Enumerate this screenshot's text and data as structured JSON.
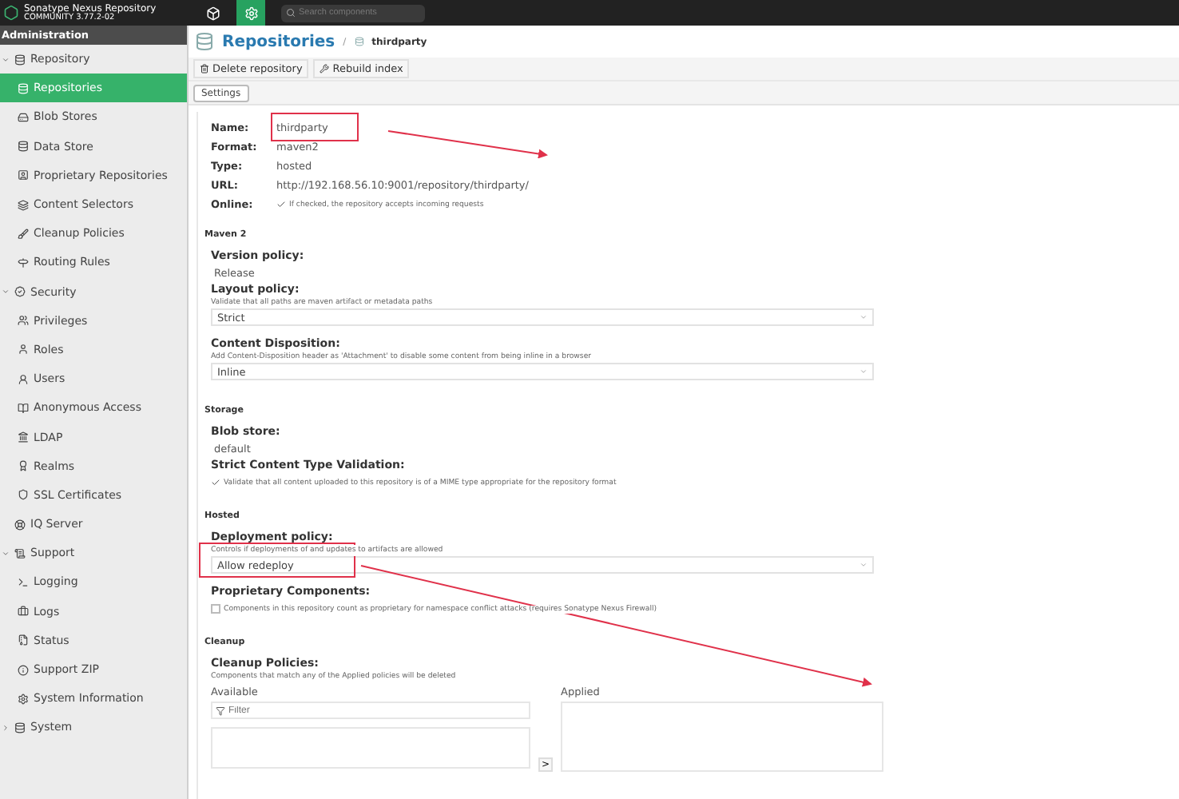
{
  "header": {
    "title": "Sonatype Nexus Repository",
    "edition": "COMMUNITY 3.77.2-02",
    "search": {
      "placeholder": "Search components"
    },
    "modes": [
      {
        "kind": "browse",
        "selected": false
      },
      {
        "kind": "admin",
        "selected": true
      }
    ]
  },
  "sidebar": {
    "title": "Administration",
    "items": [
      {
        "label": "Repository",
        "expanded": true,
        "selected": false,
        "children": [
          {
            "label": "Repositories",
            "selected": true
          },
          {
            "label": "Blob Stores",
            "selected": false
          },
          {
            "label": "Data Store",
            "selected": false
          },
          {
            "label": "Proprietary Repositories",
            "selected": false
          },
          {
            "label": "Content Selectors",
            "selected": false
          },
          {
            "label": "Cleanup Policies",
            "selected": false
          },
          {
            "label": "Routing Rules",
            "selected": false
          }
        ]
      },
      {
        "label": "Security",
        "expanded": true,
        "selected": false,
        "children": [
          {
            "label": "Privileges",
            "selected": false
          },
          {
            "label": "Roles",
            "selected": false
          },
          {
            "label": "Users",
            "selected": false
          },
          {
            "label": "Anonymous Access",
            "selected": false
          },
          {
            "label": "LDAP",
            "selected": false
          },
          {
            "label": "Realms",
            "selected": false
          },
          {
            "label": "SSL Certificates",
            "selected": false
          }
        ]
      },
      {
        "label": "IQ Server",
        "selected": false
      },
      {
        "label": "Support",
        "expanded": true,
        "selected": false,
        "children": [
          {
            "label": "Logging",
            "selected": false
          },
          {
            "label": "Logs",
            "selected": false
          },
          {
            "label": "Status",
            "selected": false
          },
          {
            "label": "Support ZIP",
            "selected": false
          },
          {
            "label": "System Information",
            "selected": false
          }
        ]
      },
      {
        "label": "System",
        "expanded": false,
        "selected": false
      }
    ]
  },
  "breadcrumb": {
    "title": "Repositories",
    "separator": "/",
    "current": "thirdparty"
  },
  "toolbar": [
    "Delete repository",
    "Rebuild index"
  ],
  "tabs": [
    {
      "label": "Settings",
      "selected": true
    }
  ],
  "summary": [
    {
      "kind": "text",
      "label": "Name:",
      "value": "thirdparty"
    },
    {
      "kind": "text",
      "label": "Format:",
      "value": "maven2"
    },
    {
      "kind": "text",
      "label": "Type:",
      "value": "hosted"
    },
    {
      "kind": "text",
      "label": "URL:",
      "value": "http://192.168.56.10:9001/repository/thirdparty/"
    },
    {
      "kind": "checkbox",
      "label": "Online:",
      "checked": true,
      "help": "If checked, the repository accepts incoming requests"
    }
  ],
  "sections": [
    {
      "title": "Maven 2",
      "fields": [
        {
          "kind": "text",
          "label": "Version policy:",
          "value": "Release"
        },
        {
          "kind": "select",
          "label": "Layout policy:",
          "help": "Validate that all paths are maven artifact or metadata paths",
          "value": "Strict"
        },
        {
          "kind": "select",
          "label": "Content Disposition:",
          "help": "Add Content-Disposition header as 'Attachment' to disable some content from being inline in a browser",
          "value": "Inline"
        }
      ]
    },
    {
      "title": "Storage",
      "fields": [
        {
          "kind": "text",
          "label": "Blob store:",
          "value": "default"
        },
        {
          "kind": "checkbox",
          "label": "Strict Content Type Validation:",
          "checked": true,
          "help": "Validate that all content uploaded to this repository is of a MIME type appropriate for the repository format"
        }
      ]
    },
    {
      "title": "Hosted",
      "fields": [
        {
          "kind": "select",
          "label": "Deployment policy:",
          "help": "Controls if deployments of and updates to artifacts are allowed",
          "value": "Allow redeploy"
        },
        {
          "kind": "checkbox",
          "label": "Proprietary Components:",
          "checked": false,
          "help": "Components in this repository count as proprietary for namespace conflict attacks (requires Sonatype Nexus Firewall)"
        }
      ]
    },
    {
      "title": "Cleanup",
      "fields": [
        {
          "kind": "transfer",
          "label": "Cleanup Policies:",
          "help": "Components that match any of the Applied policies will be deleted",
          "available": "Available",
          "applied": "Applied",
          "filter": {
            "placeholder": "Filter"
          },
          "move": ">"
        }
      ]
    }
  ]
}
